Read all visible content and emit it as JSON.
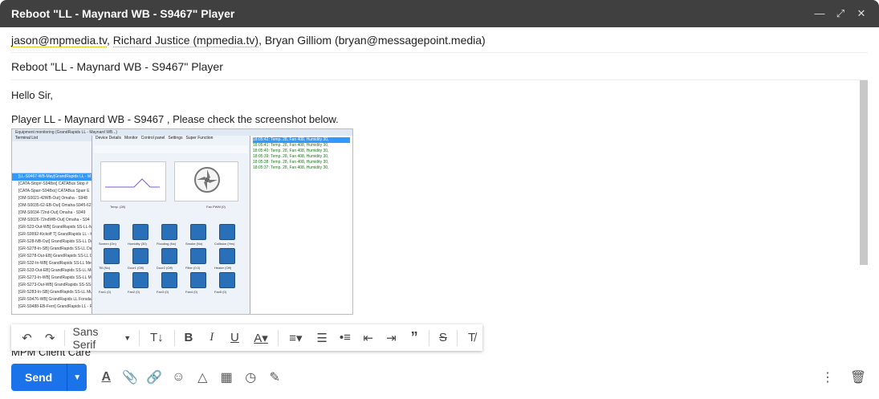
{
  "window": {
    "title": "Reboot \"LL - Maynard WB - S9467\" Player"
  },
  "recipients": [
    "jason@mpmedia.tv",
    "Richard Justice (mpmedia.tv)",
    "Bryan Gilliom (bryan@messagepoint.media)"
  ],
  "subject": "Reboot \"LL - Maynard WB - S9467\" Player",
  "body": {
    "greeting": "Hello Sir,",
    "line1": "Player LL - Maynard WB - S9467 , Please check the screenshot below."
  },
  "screenshot": {
    "window_title": "Equipment monitoring (GrandRapids LL - Maynard WB...)",
    "tabs": [
      "Device Details",
      "Monitor",
      "Control panel",
      "Settings",
      "Super Function"
    ],
    "terminal_list": "Terminal List",
    "items": [
      "[LL-S9467-WB-May]GrandRapids LL - M",
      "[CATA-Stop#-S948xx] CATABus Stop #",
      "[CATA-Sparr-S948xx] CATABus Sparr E",
      "[OM-S0021-42WB-Out] Omaha - S948",
      "[OM-S0035-62-EB-Out] Omaha-S945-62",
      "[OM-S0034-72nd-Out] Omaha - S949",
      "[OM-S0026-72ndWB-Out] Omaha - S94",
      "[GR-S23-Out-WB] GrandRapids SS-LL-M",
      "[GR-S9992-Kickoff T] GrandRapids LL - K",
      "[GR-S28-NB-Out] GrandRapids SS-LL De",
      "[GR-S278-In-SB] GrandRapids SS-LL Da",
      "[GR-S278-Out-EB] GrandRapids SS-LL D",
      "[GR-S32-In-WB] GrandRapids SS-LL Medi",
      "[GR-S33-Out-EB] GrandRapids SS-LL Med",
      "[GR-S273-In-WB] GrandRapids SS-LL Mi",
      "[GR-S273-Out-WB] GrandRapids SS-SS-",
      "[GR-S283-In-SB] GrandRapids SS-LL Mu",
      "[GR-S9476-WB] GrandRapids LL Forsdal",
      "[GR-S9488-EB-Ferri] GrandRapids LL - Fr"
    ],
    "tiles": [
      "Temp. (28)",
      "Fan PWM (0)",
      "Screen (On)",
      "Humidity (30)",
      "Flooding (No)",
      "Smoke (No)",
      "Collision (Yes)",
      "Tilt (No)",
      "Door1 (Off)",
      "Door2 (Off)",
      "Filter (0.0)",
      "Heater (Off)",
      "Fan1 (0)",
      "Fan2 (0)",
      "Fan3 (0)",
      "Fan4 (0)",
      "Fan5 (0)"
    ],
    "log": [
      "18:05:42: Temp. 28, Fan 408, Humidity 30,",
      "18:05:41: Temp. 28, Fan 408, Humidity 30,",
      "18:05:40: Temp. 28, Fan 408, Humidity 30,",
      "18:05:39: Temp. 28, Fan 408, Humidity 30,",
      "18:05:38: Temp. 28, Fan 408, Humidity 30,",
      "18:05:37: Temp. 28, Fan 408, Humidity 30,"
    ]
  },
  "signature": "MPM Client Care",
  "toolbar": {
    "font_name": "Sans Serif"
  },
  "send": {
    "label": "Send"
  }
}
